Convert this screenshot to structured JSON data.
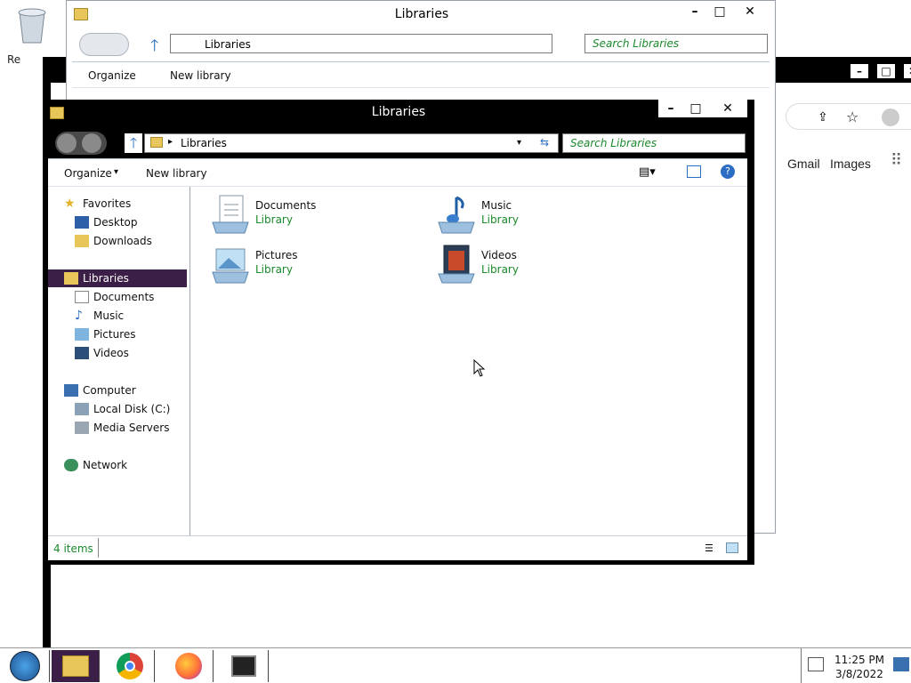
{
  "desktop": {
    "recycle_label": "Re"
  },
  "chrome_bg": {
    "links": [
      "Gmail",
      "Images"
    ]
  },
  "back_window": {
    "title": "Libraries",
    "breadcrumb": "Libraries",
    "search_placeholder": "Search Libraries",
    "toolbar": {
      "organize": "Organize",
      "new_library": "New library"
    }
  },
  "window": {
    "title": "Libraries",
    "breadcrumb": "Libraries",
    "search_placeholder": "Search Libraries",
    "toolbar": {
      "organize": "Organize",
      "new_library": "New library"
    },
    "nav": {
      "favorites": "Favorites",
      "desktop": "Desktop",
      "downloads": "Downloads",
      "libraries": "Libraries",
      "documents": "Documents",
      "music": "Music",
      "pictures": "Pictures",
      "videos": "Videos",
      "computer": "Computer",
      "local_disk": "Local Disk (C:)",
      "media_servers": "Media Servers",
      "network": "Network"
    },
    "libraries": [
      {
        "name": "Documents",
        "type": "Library"
      },
      {
        "name": "Music",
        "type": "Library"
      },
      {
        "name": "Pictures",
        "type": "Library"
      },
      {
        "name": "Videos",
        "type": "Library"
      }
    ],
    "status": "4 items"
  },
  "taskbar": {
    "time": "11:25 PM",
    "date": "3/8/2022"
  },
  "colors": {
    "accent_green": "#1a8a2b",
    "selection": "#3b1f46",
    "titlebar": "#000000"
  }
}
